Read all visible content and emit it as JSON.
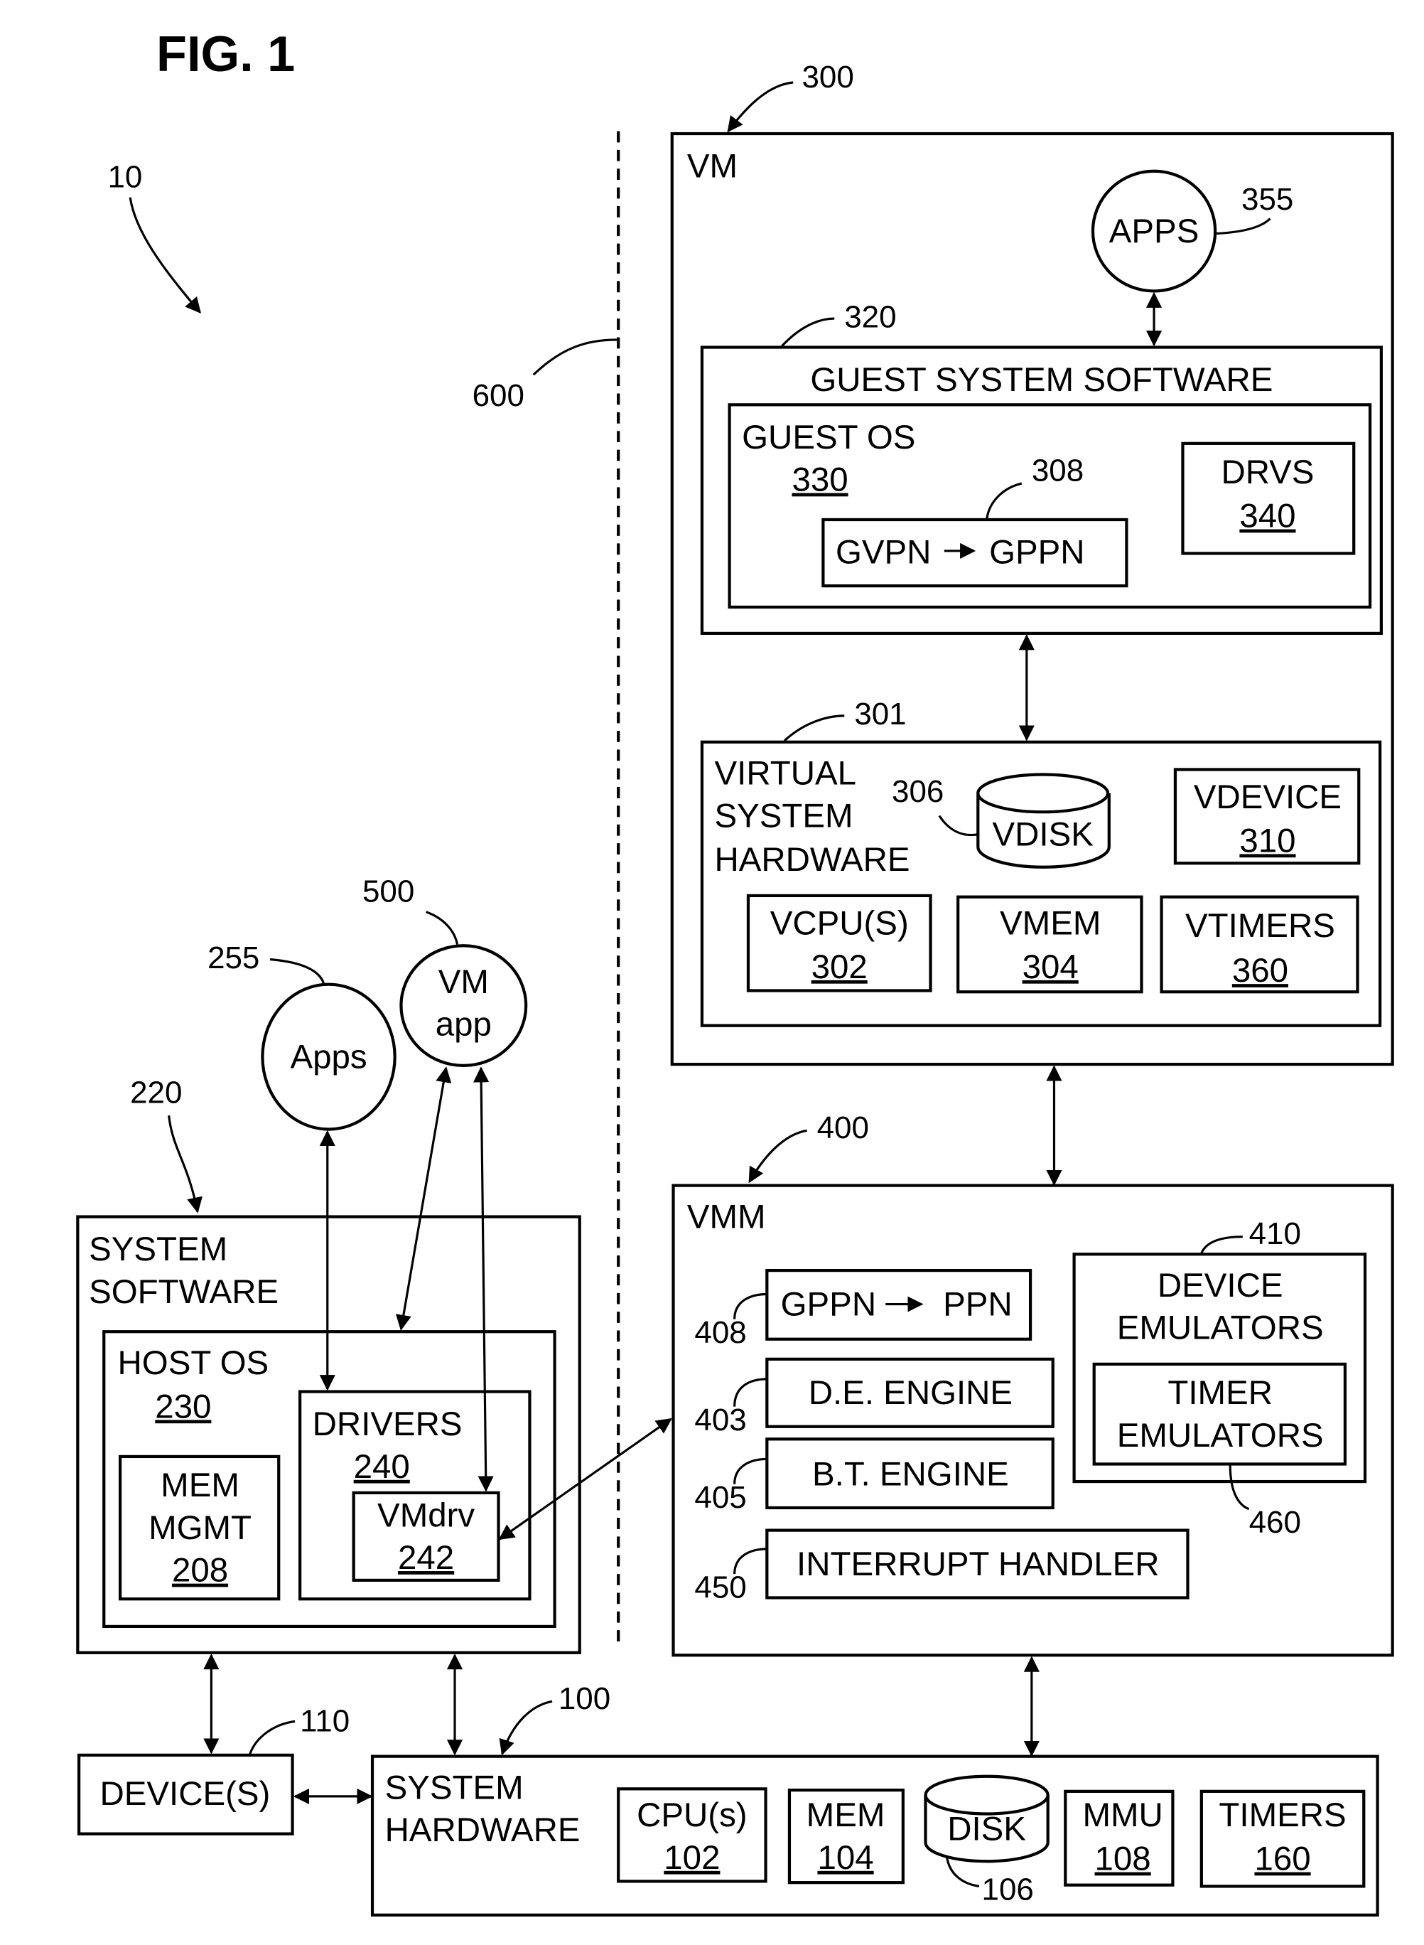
{
  "figure": {
    "title": "FIG. 1",
    "system_ref": "10",
    "divider_ref": "600"
  },
  "vm": {
    "ref": "300",
    "label": "VM",
    "apps": {
      "label": "APPS",
      "ref": "355"
    },
    "guest_system_software": {
      "ref": "320",
      "label": "GUEST SYSTEM SOFTWARE",
      "guest_os": {
        "label": "GUEST OS",
        "num": "330",
        "mapping": {
          "ref": "308",
          "from": "GVPN",
          "to": "GPPN"
        }
      },
      "drvs": {
        "label": "DRVS",
        "num": "340"
      }
    },
    "virtual_hardware": {
      "ref": "301",
      "label_lines": [
        "VIRTUAL",
        "SYSTEM",
        "HARDWARE"
      ],
      "vdisk": {
        "label": "VDISK",
        "ref": "306"
      },
      "vdevice": {
        "label": "VDEVICE",
        "num": "310"
      },
      "vcpu": {
        "label": "VCPU(S)",
        "num": "302"
      },
      "vmem": {
        "label": "VMEM",
        "num": "304"
      },
      "vtimers": {
        "label": "VTIMERS",
        "num": "360"
      }
    }
  },
  "vmm": {
    "ref": "400",
    "label": "VMM",
    "mapping": {
      "ref": "408",
      "from": "GPPN",
      "to": "PPN"
    },
    "de_engine": {
      "ref": "403",
      "label": "D.E. ENGINE"
    },
    "bt_engine": {
      "ref": "405",
      "label": "B.T. ENGINE"
    },
    "interrupt_handler": {
      "ref": "450",
      "label": "INTERRUPT HANDLER"
    },
    "device_emulators": {
      "ref": "410",
      "label_lines": [
        "DEVICE",
        "EMULATORS"
      ],
      "timer_emulators": {
        "ref": "460",
        "label_lines": [
          "TIMER",
          "EMULATORS"
        ]
      }
    }
  },
  "host": {
    "apps": {
      "label": "Apps",
      "ref": "255"
    },
    "vm_app": {
      "label_lines": [
        "VM",
        "app"
      ],
      "ref": "500"
    },
    "system_software": {
      "ref": "220",
      "label_lines": [
        "SYSTEM",
        "SOFTWARE"
      ],
      "host_os": {
        "label": "HOST OS",
        "num": "230"
      },
      "mem_mgmt": {
        "label_lines": [
          "MEM",
          "MGMT"
        ],
        "num": "208"
      },
      "drivers": {
        "label": "DRIVERS",
        "num": "240"
      },
      "vmdrv": {
        "label": "VMdrv",
        "num": "242"
      }
    }
  },
  "devices": {
    "label": "DEVICE(S)",
    "ref": "110"
  },
  "system_hardware": {
    "ref": "100",
    "label_lines": [
      "SYSTEM",
      "HARDWARE"
    ],
    "cpu": {
      "label": "CPU(s)",
      "num": "102"
    },
    "mem": {
      "label": "MEM",
      "num": "104"
    },
    "disk": {
      "label": "DISK",
      "ref": "106"
    },
    "mmu": {
      "label": "MMU",
      "num": "108"
    },
    "timers": {
      "label": "TIMERS",
      "num": "160"
    }
  }
}
